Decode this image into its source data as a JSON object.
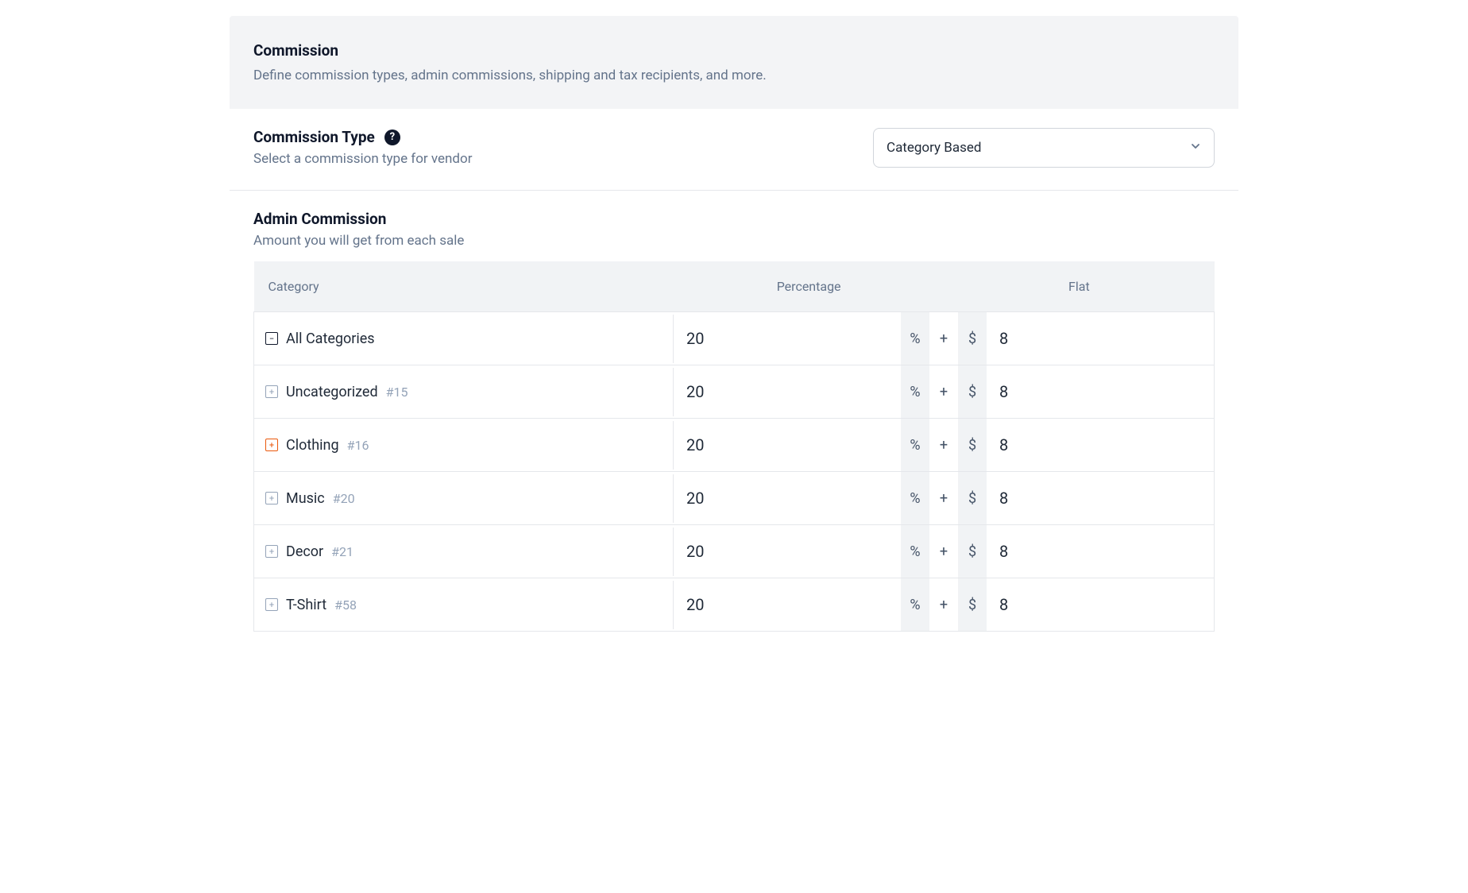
{
  "header": {
    "title": "Commission",
    "subtitle": "Define commission types, admin commissions, shipping and tax recipients, and more."
  },
  "commission_type": {
    "label": "Commission Type",
    "description": "Select a commission type for vendor",
    "selected": "Category Based",
    "help_char": "?"
  },
  "admin_commission": {
    "label": "Admin Commission",
    "description": "Amount you will get from each sale"
  },
  "table": {
    "headers": {
      "category": "Category",
      "percentage": "Percentage",
      "flat": "Flat"
    },
    "symbols": {
      "percent": "%",
      "plus": "+",
      "currency": "$"
    },
    "rows": [
      {
        "name": "All Categories",
        "id": "",
        "percentage": "20",
        "flat": "8",
        "icon_type": "collapse"
      },
      {
        "name": "Uncategorized",
        "id": "#15",
        "percentage": "20",
        "flat": "8",
        "icon_type": "plus"
      },
      {
        "name": "Clothing",
        "id": "#16",
        "percentage": "20",
        "flat": "8",
        "icon_type": "plus-orange"
      },
      {
        "name": "Music",
        "id": "#20",
        "percentage": "20",
        "flat": "8",
        "icon_type": "plus"
      },
      {
        "name": "Decor",
        "id": "#21",
        "percentage": "20",
        "flat": "8",
        "icon_type": "plus"
      },
      {
        "name": "T-Shirt",
        "id": "#58",
        "percentage": "20",
        "flat": "8",
        "icon_type": "plus"
      }
    ]
  }
}
